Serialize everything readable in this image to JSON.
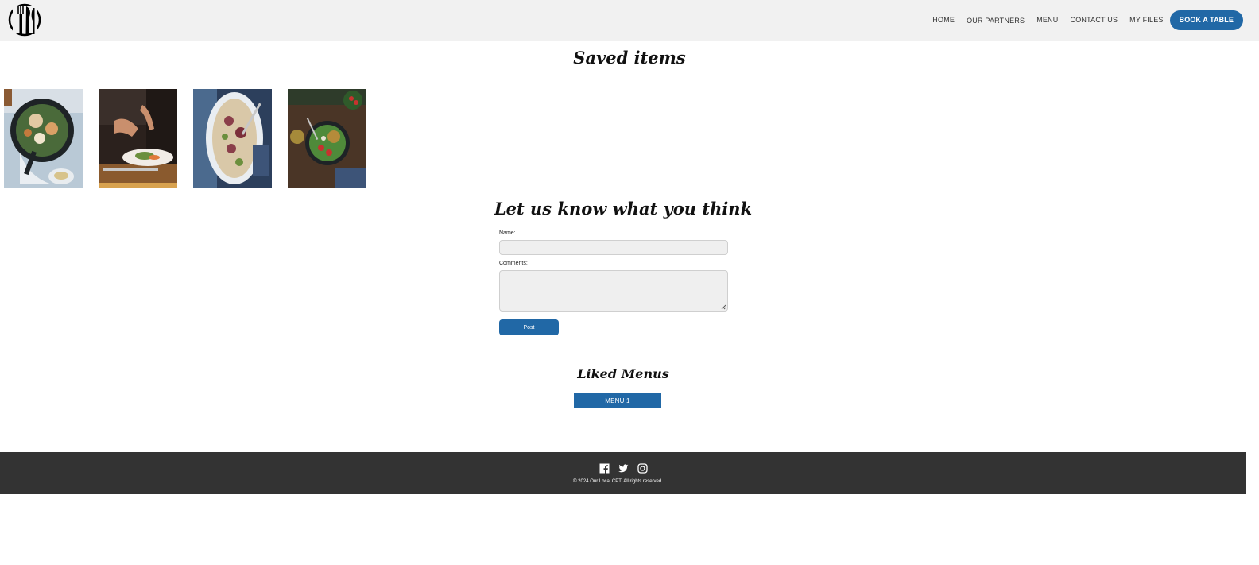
{
  "header": {
    "nav": [
      "HOME",
      "OUR PARTNERS",
      "MENU",
      "CONTACT US",
      "MY FILES"
    ],
    "book_label": "BOOK A TABLE"
  },
  "saved": {
    "title": "Saved items",
    "images": [
      {
        "icon": "skillet-dish-photo"
      },
      {
        "icon": "chef-plating-photo"
      },
      {
        "icon": "pasta-platter-photo"
      },
      {
        "icon": "salad-bowl-photo"
      }
    ]
  },
  "feedback": {
    "title": "Let us know what you think",
    "name_label": "Name:",
    "name_value": "",
    "comments_label": "Comments:",
    "comments_value": "",
    "post_label": "Post"
  },
  "liked": {
    "title": "Liked Menus",
    "menus": [
      "MENU 1"
    ]
  },
  "footer": {
    "social_icons": [
      "facebook-icon",
      "twitter-icon",
      "instagram-icon"
    ],
    "copyright": "© 2024 Our Local CPT. All rights reserved."
  },
  "colors": {
    "accent": "#2168a6",
    "header_bg": "#f1f1f1",
    "footer_bg": "#333333"
  }
}
